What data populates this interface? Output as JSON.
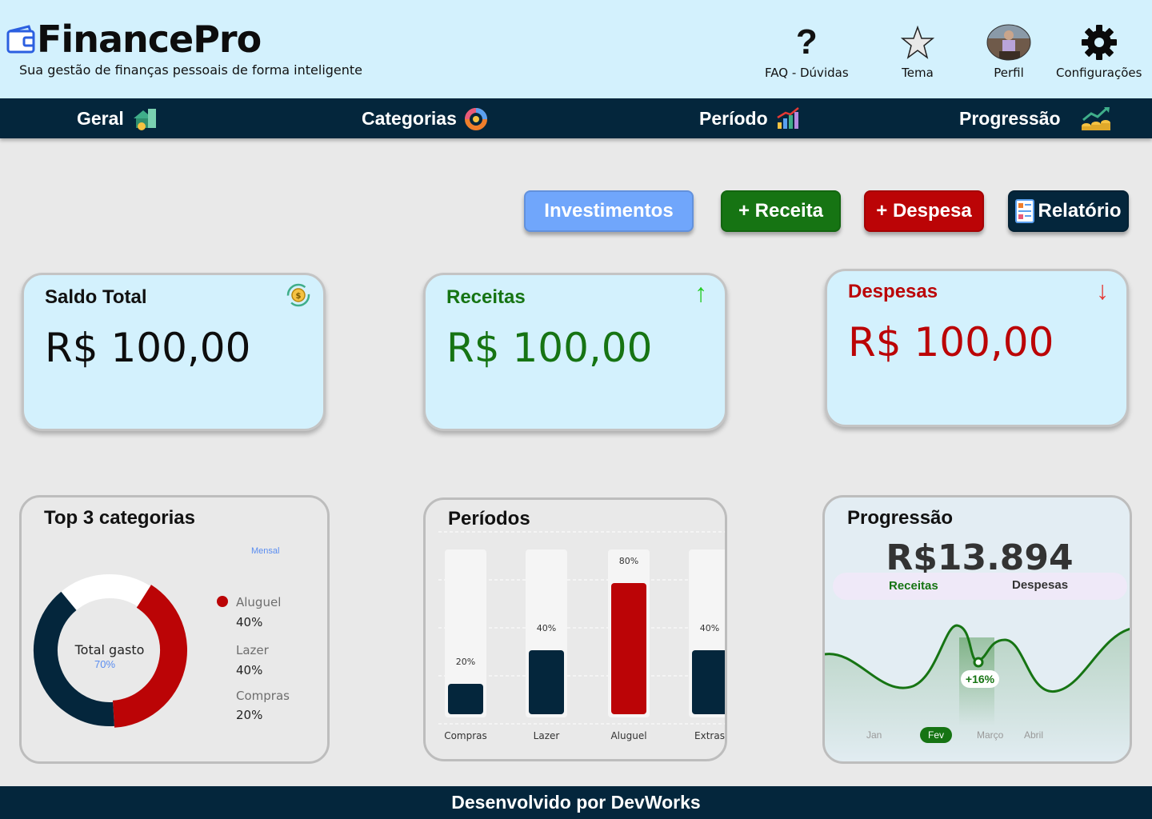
{
  "app": {
    "name": "FinancePro",
    "tagline": "Sua gestão de finanças pessoais de forma inteligente"
  },
  "header_actions": [
    {
      "label": "FAQ - Dúvidas",
      "icon": "question-icon"
    },
    {
      "label": "Tema",
      "icon": "star-icon"
    },
    {
      "label": "Perfil",
      "icon": "avatar"
    },
    {
      "label": "Configurações",
      "icon": "gear-icon"
    }
  ],
  "nav": [
    {
      "label": "Geral",
      "icon": "money-house-icon"
    },
    {
      "label": "Categorias",
      "icon": "category-donut-icon"
    },
    {
      "label": "Período",
      "icon": "bar-chart-icon"
    },
    {
      "label": "Progressão",
      "icon": "growth-coins-icon"
    }
  ],
  "buttons": {
    "investimentos": "Investimentos",
    "receita": "+ Receita",
    "despesa": "+ Despesa",
    "relatorio": "Relatório"
  },
  "cards": {
    "saldo": {
      "title": "Saldo Total",
      "value": "R$ 100,00"
    },
    "receitas": {
      "title": "Receitas",
      "value": "R$ 100,00",
      "arrow": "↑"
    },
    "despesas": {
      "title": "Despesas",
      "value": "R$ 100,00",
      "arrow": "↓"
    }
  },
  "colors": {
    "navy": "#04263c",
    "green": "#167413",
    "red": "#bb0406",
    "light_blue": "#d3f1fd",
    "invest_blue": "#70a6fb"
  },
  "top3": {
    "title": "Top 3 categorias",
    "filter": "Mensal",
    "center_label": "Total gasto",
    "center_value": "70%",
    "items": [
      {
        "name": "Aluguel",
        "pct": "40%"
      },
      {
        "name": "Lazer",
        "pct": "40%"
      },
      {
        "name": "Compras",
        "pct": "20%"
      }
    ]
  },
  "periodos": {
    "title": "Períodos"
  },
  "progressao": {
    "title": "Progressão",
    "amount": "R$13.894",
    "tab_receitas": "Receitas",
    "tab_despesas": "Despesas",
    "badge": "+16%",
    "months": [
      "Jan",
      "Fev",
      "Março",
      "Abril"
    ],
    "selected_month": "Fev"
  },
  "chart_data": [
    {
      "type": "pie",
      "categories": [
        "Aluguel",
        "Lazer",
        "Compras"
      ],
      "values": [
        40,
        40,
        20
      ],
      "title": "Top 3 categorias"
    },
    {
      "type": "bar",
      "title": "Períodos",
      "categories": [
        "Compras",
        "Lazer",
        "Aluguel",
        "Extras"
      ],
      "values": [
        20,
        40,
        80,
        40
      ],
      "value_labels": [
        "20%",
        "40%",
        "80%",
        "40%"
      ],
      "ylim": [
        0,
        100
      ],
      "highlight": "Aluguel"
    },
    {
      "type": "line",
      "title": "Progressão",
      "x": [
        "Jan",
        "Fev",
        "Março",
        "Abril"
      ],
      "annotation": "+16%"
    }
  ],
  "footer": "Desenvolvido por DevWorks"
}
